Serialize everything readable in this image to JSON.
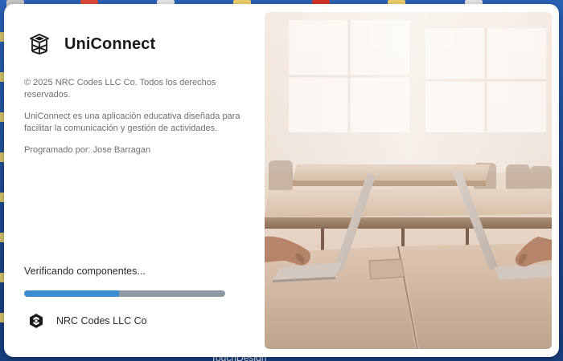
{
  "app": {
    "title": "UniConnect",
    "icon": "building-icon"
  },
  "info": {
    "copyright": "© 2025 NRC Codes LLC Co. Todos los derechos reservados.",
    "description": "UniConnect es una aplicación educativa diseñada para facilitar la comunicación y gestión de actividades.",
    "author": "Programado por: Jose Barragan"
  },
  "loading": {
    "status": "Verificando componentes...",
    "progress_fraction": 0.47
  },
  "footer": {
    "company": "NRC Codes LLC Co",
    "icon": "nrc-logo-icon"
  },
  "desktop": {
    "taskbar_label": "TouchDesign"
  },
  "colors": {
    "accent": "#3d8cd0",
    "progress_track": "#8d9aa3",
    "title_text": "#1a1a1a",
    "body_text": "#6f6f6f"
  }
}
